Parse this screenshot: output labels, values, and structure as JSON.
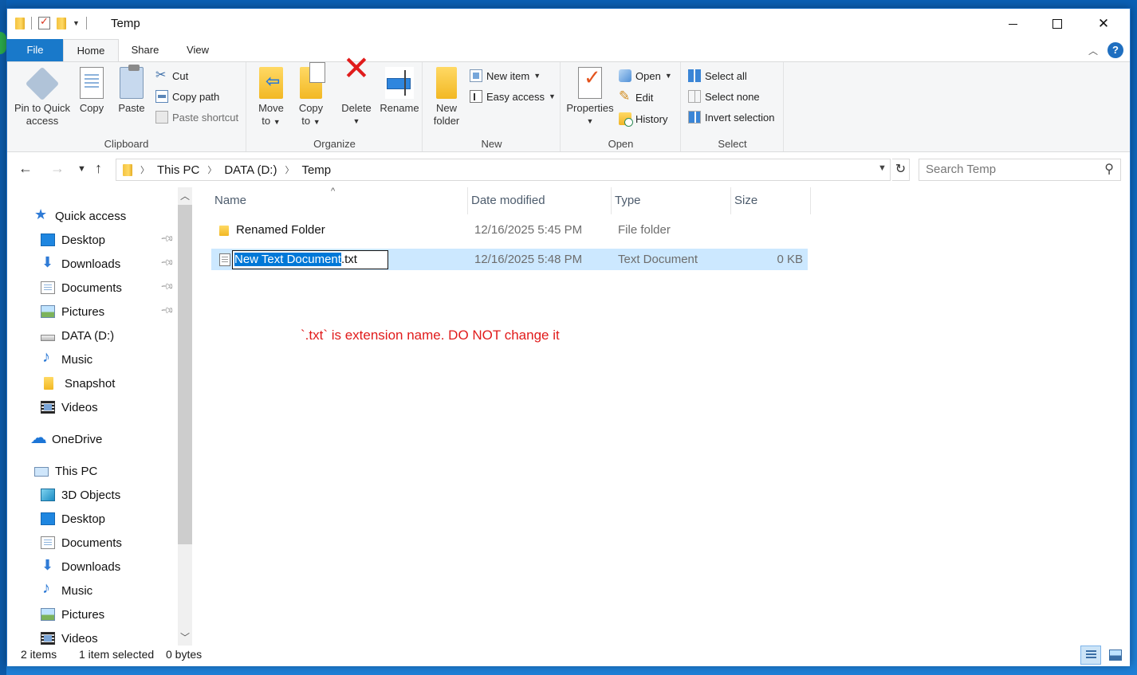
{
  "window": {
    "title": "Temp"
  },
  "ribbon": {
    "tabs": [
      "File",
      "Home",
      "Share",
      "View"
    ],
    "help_label": "?",
    "clipboard": {
      "label": "Clipboard",
      "pin": "Pin to Quick access",
      "pin_line1": "Pin to Quick",
      "pin_line2": "access",
      "copy": "Copy",
      "paste": "Paste",
      "cut": "Cut",
      "copy_path": "Copy path",
      "paste_shortcut": "Paste shortcut"
    },
    "organize": {
      "label": "Organize",
      "move_line1": "Move",
      "move_line2": "to",
      "copy_line1": "Copy",
      "copy_line2": "to",
      "delete": "Delete",
      "rename": "Rename"
    },
    "new": {
      "label": "New",
      "folder_line1": "New",
      "folder_line2": "folder",
      "new_item": "New item",
      "easy_access": "Easy access"
    },
    "open": {
      "label": "Open",
      "properties": "Properties",
      "open": "Open",
      "edit": "Edit",
      "history": "History"
    },
    "select": {
      "label": "Select",
      "select_all": "Select all",
      "select_none": "Select none",
      "invert": "Invert selection"
    }
  },
  "address": {
    "crumbs": [
      "This PC",
      "DATA (D:)",
      "Temp"
    ],
    "search_placeholder": "Search Temp"
  },
  "nav": {
    "quick_access": "Quick access",
    "quick_items": [
      {
        "label": "Desktop",
        "icon": "desktop-icon",
        "pinned": true
      },
      {
        "label": "Downloads",
        "icon": "downloads-icon",
        "pinned": true
      },
      {
        "label": "Documents",
        "icon": "documents-icon",
        "pinned": true
      },
      {
        "label": "Pictures",
        "icon": "pictures-icon",
        "pinned": true
      },
      {
        "label": "DATA (D:)",
        "icon": "drive-icon",
        "pinned": false
      },
      {
        "label": "Music",
        "icon": "music-icon",
        "pinned": false
      },
      {
        "label": "Snapshot",
        "icon": "folder-icon",
        "pinned": false
      },
      {
        "label": "Videos",
        "icon": "videos-icon",
        "pinned": false
      }
    ],
    "onedrive": "OneDrive",
    "this_pc": "This PC",
    "pc_items": [
      {
        "label": "3D Objects",
        "icon": "3d-objects-icon"
      },
      {
        "label": "Desktop",
        "icon": "desktop-icon"
      },
      {
        "label": "Documents",
        "icon": "documents-icon"
      },
      {
        "label": "Downloads",
        "icon": "downloads-icon"
      },
      {
        "label": "Music",
        "icon": "music-icon"
      },
      {
        "label": "Pictures",
        "icon": "pictures-icon"
      },
      {
        "label": "Videos",
        "icon": "videos-icon"
      }
    ]
  },
  "files": {
    "columns": [
      "Name",
      "Date modified",
      "Type",
      "Size"
    ],
    "rows": [
      {
        "name": "Renamed Folder",
        "date": "12/16/2025 5:45 PM",
        "type": "File folder",
        "size": "",
        "icon": "folder-icon"
      },
      {
        "name": "New Text Document.txt",
        "rename_selected": "New Text Document",
        "rename_rest": ".txt",
        "date": "12/16/2025 5:48 PM",
        "type": "Text Document",
        "size": "0 KB",
        "icon": "text-file-icon",
        "selected": true
      }
    ],
    "note": "`.txt` is extension name. DO NOT change it"
  },
  "status": {
    "items": "2 items",
    "selected": "1 item selected",
    "size": "0 bytes"
  },
  "colors": {
    "accent": "#1979ca",
    "selection": "#cce8ff",
    "note": "#e11b1b"
  }
}
